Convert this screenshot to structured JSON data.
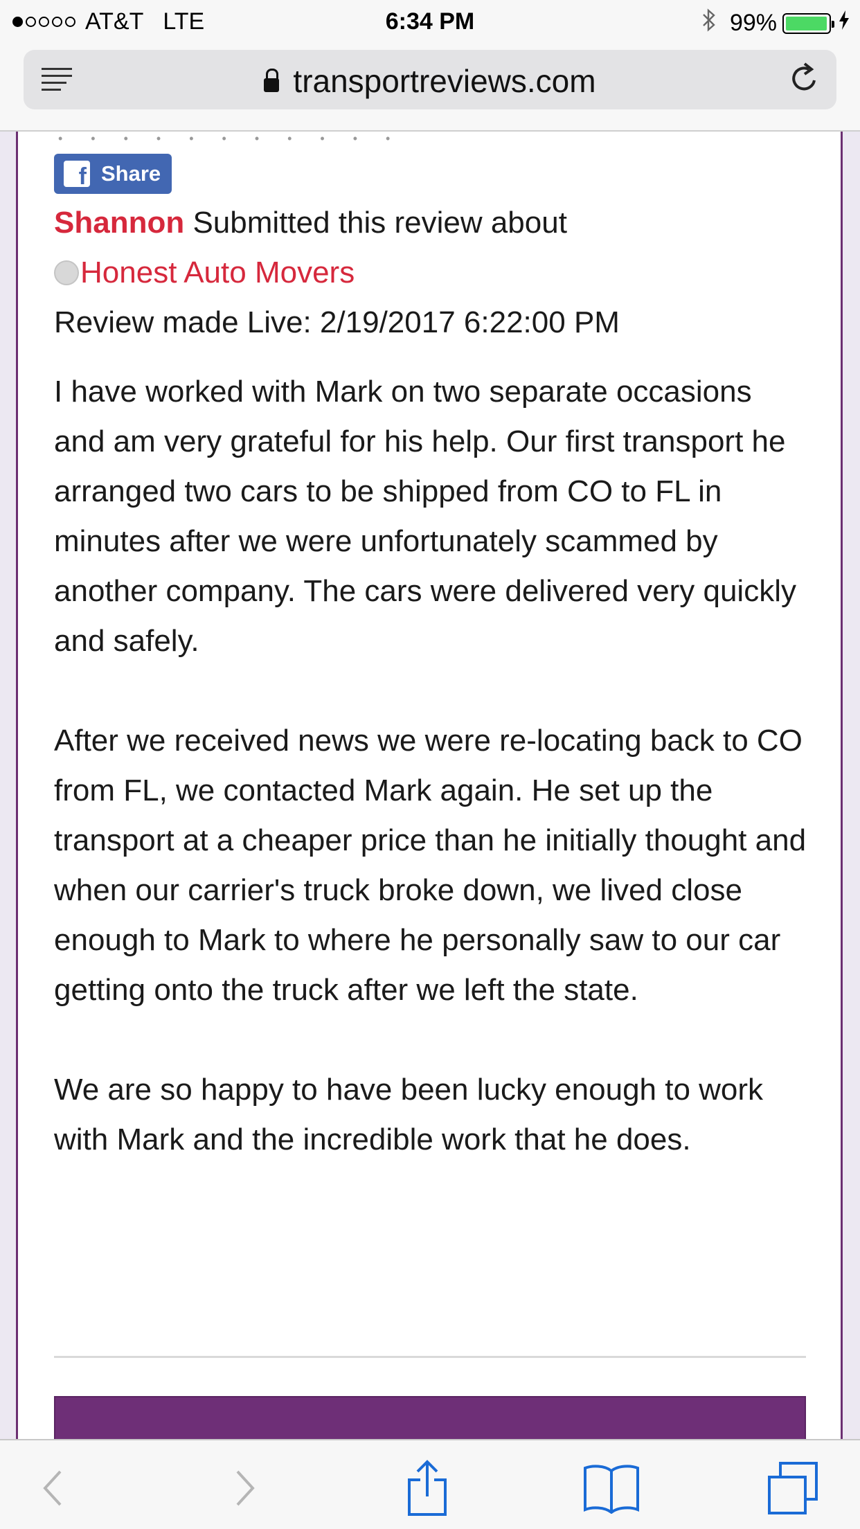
{
  "status_bar": {
    "carrier": "AT&T",
    "network": "LTE",
    "time": "6:34 PM",
    "battery_percent": "99%",
    "battery_level": 0.99,
    "signal_bars_filled": 1,
    "signal_bars_total": 5,
    "battery_color": "#4cd964"
  },
  "browser": {
    "url": "transportreviews.com",
    "icons": [
      "reader-icon",
      "lock-icon",
      "reload-icon"
    ]
  },
  "review": {
    "share_label": "Share",
    "reviewer": "Shannon",
    "submitted_text": "Submitted this review about",
    "company": "Honest Auto Movers",
    "live_date": "Review made Live: 2/19/2017 6:22:00 PM",
    "paragraphs": [
      "I have worked with Mark on two separate occasions and am very grateful for his help. Our first transport he arranged two cars to be shipped from CO to FL in minutes after we were unfortunately scammed by another company. The cars were delivered very quickly and safely.",
      "After we received news we were re-locating back to CO from FL, we contacted Mark again. He set up the transport at a cheaper price than he initially thought and when our carrier's truck broke down, we lived close enough to Mark to where he personally saw to our car getting onto the truck after we left the state.",
      "We are so happy to have been lucky enough to work with Mark and the incredible work that he does."
    ]
  },
  "colors": {
    "accent_red": "#d6283c",
    "frame_purple": "#6e2f77",
    "facebook_blue": "#4267b2",
    "toolbar_blue": "#1a6bd6"
  },
  "toolbar": {
    "items": [
      "back-icon",
      "forward-icon",
      "share-icon",
      "bookmarks-icon",
      "tabs-icon"
    ]
  }
}
